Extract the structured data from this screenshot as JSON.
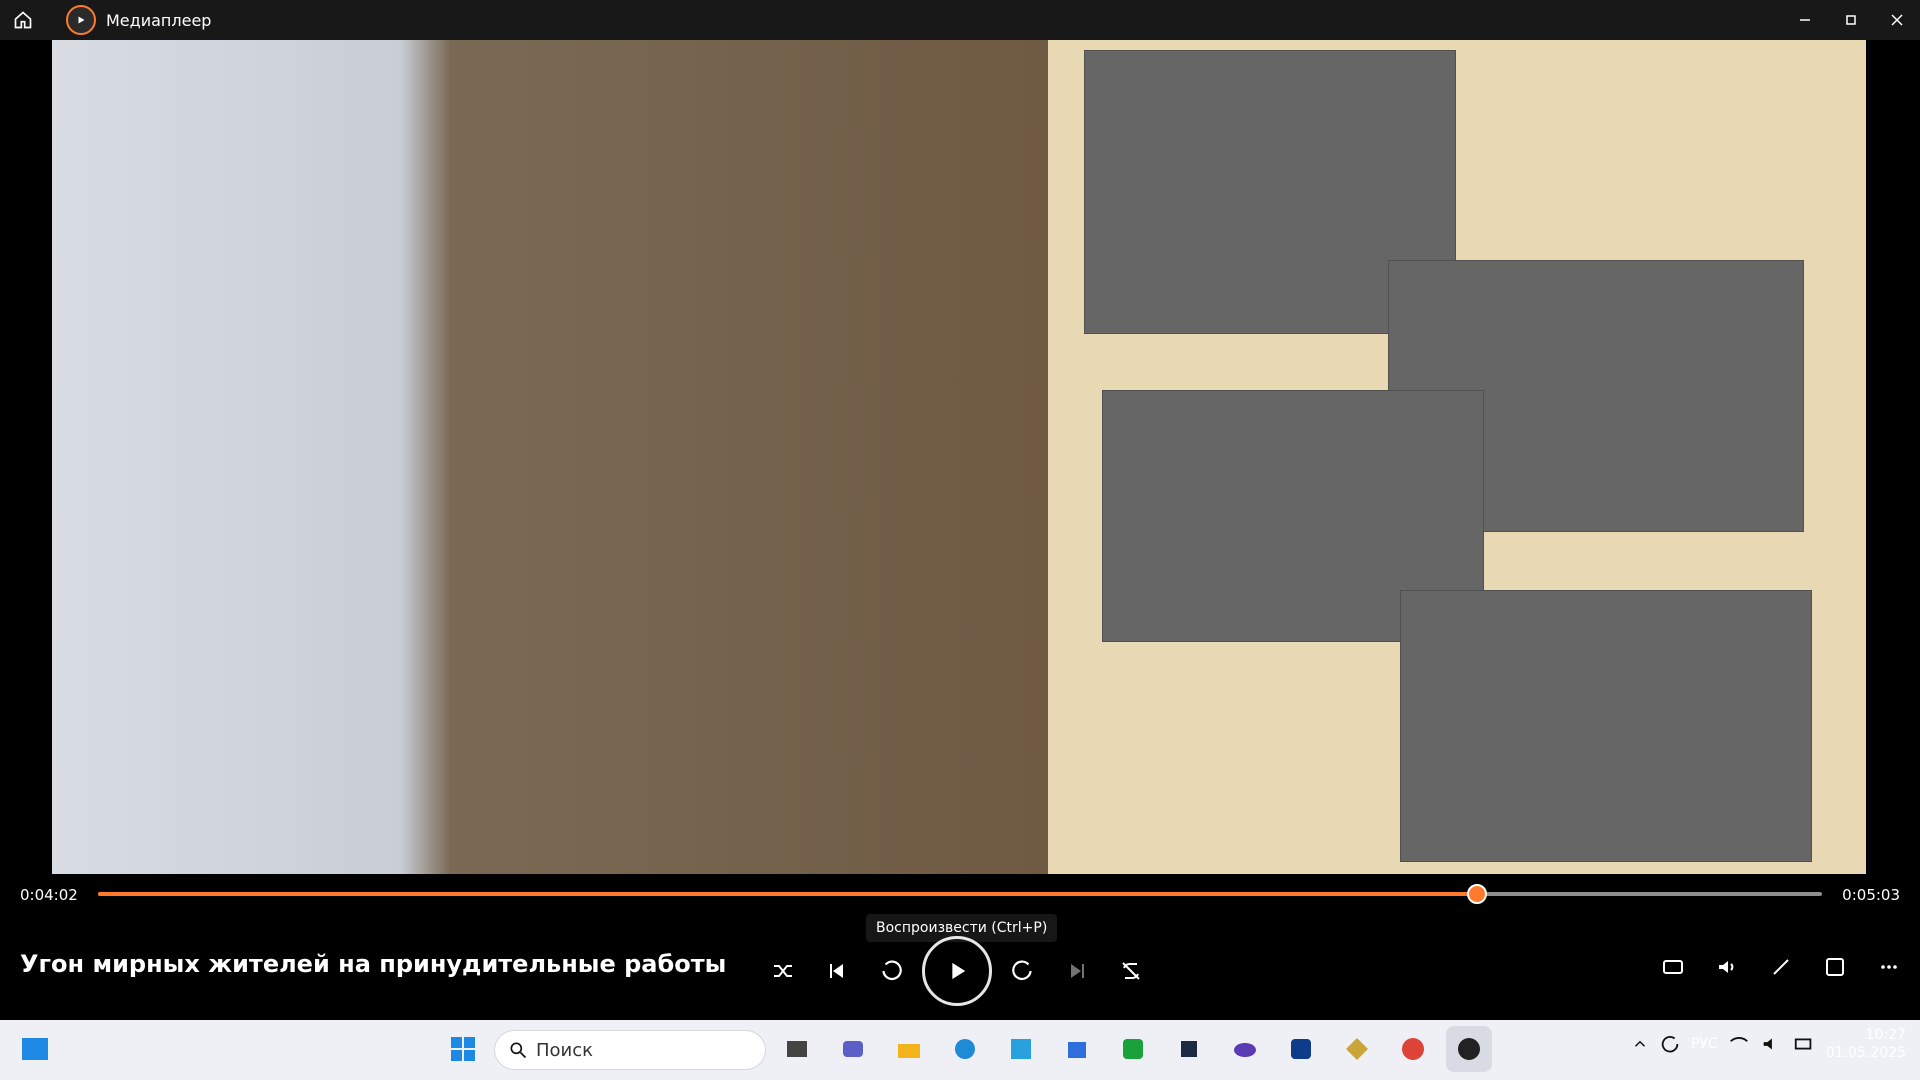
{
  "window": {
    "title": "Медиаплеер",
    "home_icon": "home-icon",
    "app_icon": "media-player-icon",
    "controls": [
      {
        "name": "minimize-button",
        "icon": "minimize-icon"
      },
      {
        "name": "maximize-button",
        "icon": "maximize-icon"
      },
      {
        "name": "close-button",
        "icon": "close-icon"
      }
    ]
  },
  "video": {
    "title": "Угон мирных жителей на принудительные работы",
    "current_time": "0:04:02",
    "total_time": "0:05:03",
    "progress": 0.8
  },
  "tooltip": {
    "text": "Воспроизвести (Ctrl+P)"
  },
  "controls": {
    "shuffle": "shuffle-icon",
    "previous": "previous-icon",
    "skip_back_10": "skip-back-10-icon",
    "play": "play-icon",
    "skip_forward_30": "skip-forward-30-icon",
    "next": "next-icon",
    "repeat": "repeat-off-icon",
    "right": [
      "captions-icon",
      "volume-icon",
      "fullscreen-icon",
      "miniplayer-icon",
      "more-icon"
    ]
  },
  "taskbar": {
    "search_placeholder": "Поиск",
    "apps": [
      "windows-start-icon",
      "search-icon",
      "task-view-icon",
      "teams-icon",
      "file-explorer-icon",
      "edge-icon",
      "photos-icon",
      "store-icon",
      "xbox-icon",
      "game-icon",
      "gamepad-icon",
      "shield-icon",
      "other-app-icon",
      "chrome-icon",
      "media-player-icon"
    ],
    "tray": {
      "language": "РУС",
      "time": "10:27",
      "date": "01.05.2025",
      "icons": [
        "chevron-up-icon",
        "sync-icon",
        "wifi-icon",
        "volume-icon",
        "battery-icon"
      ]
    }
  },
  "colors": {
    "accent": "#ff7a2a",
    "taskbar": "#eef0f5"
  }
}
